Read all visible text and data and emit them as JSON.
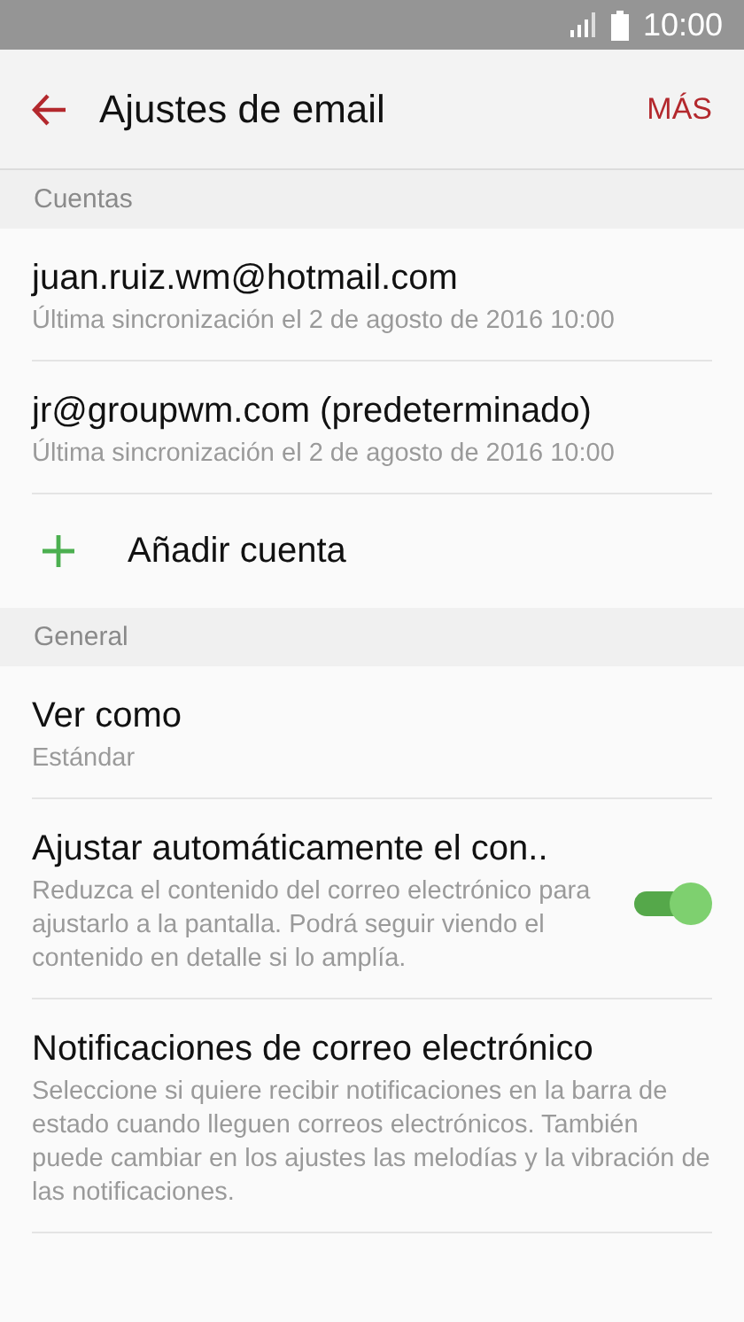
{
  "status_bar": {
    "time": "10:00"
  },
  "header": {
    "title": "Ajustes de email",
    "more": "MÁS"
  },
  "sections": [
    {
      "title": "Cuentas",
      "items": [
        {
          "kind": "account",
          "title": "juan.ruiz.wm@hotmail.com",
          "subtitle": "Última sincronización el 2 de agosto de 2016  10:00"
        },
        {
          "kind": "account",
          "title": "jr@groupwm.com (predeterminado)",
          "subtitle": "Última sincronización el 2 de agosto de 2016  10:00"
        },
        {
          "kind": "add",
          "title": "Añadir cuenta"
        }
      ]
    },
    {
      "title": "General",
      "items": [
        {
          "kind": "text",
          "title": "Ver como",
          "subtitle": "Estándar"
        },
        {
          "kind": "switch",
          "title": "Ajustar automáticamente el con..",
          "subtitle": "Reduzca el contenido del correo electrónico para ajustarlo a la pantalla. Podrá seguir viendo el contenido en detalle si lo amplía.",
          "on": true
        },
        {
          "kind": "text",
          "title": "Notificaciones de correo electrónico",
          "subtitle": "Seleccione si quiere recibir notificaciones en la barra de estado cuando lleguen correos electrónicos. También puede cambiar en los ajustes las melodías y la vibración de las notificaciones."
        }
      ]
    }
  ]
}
